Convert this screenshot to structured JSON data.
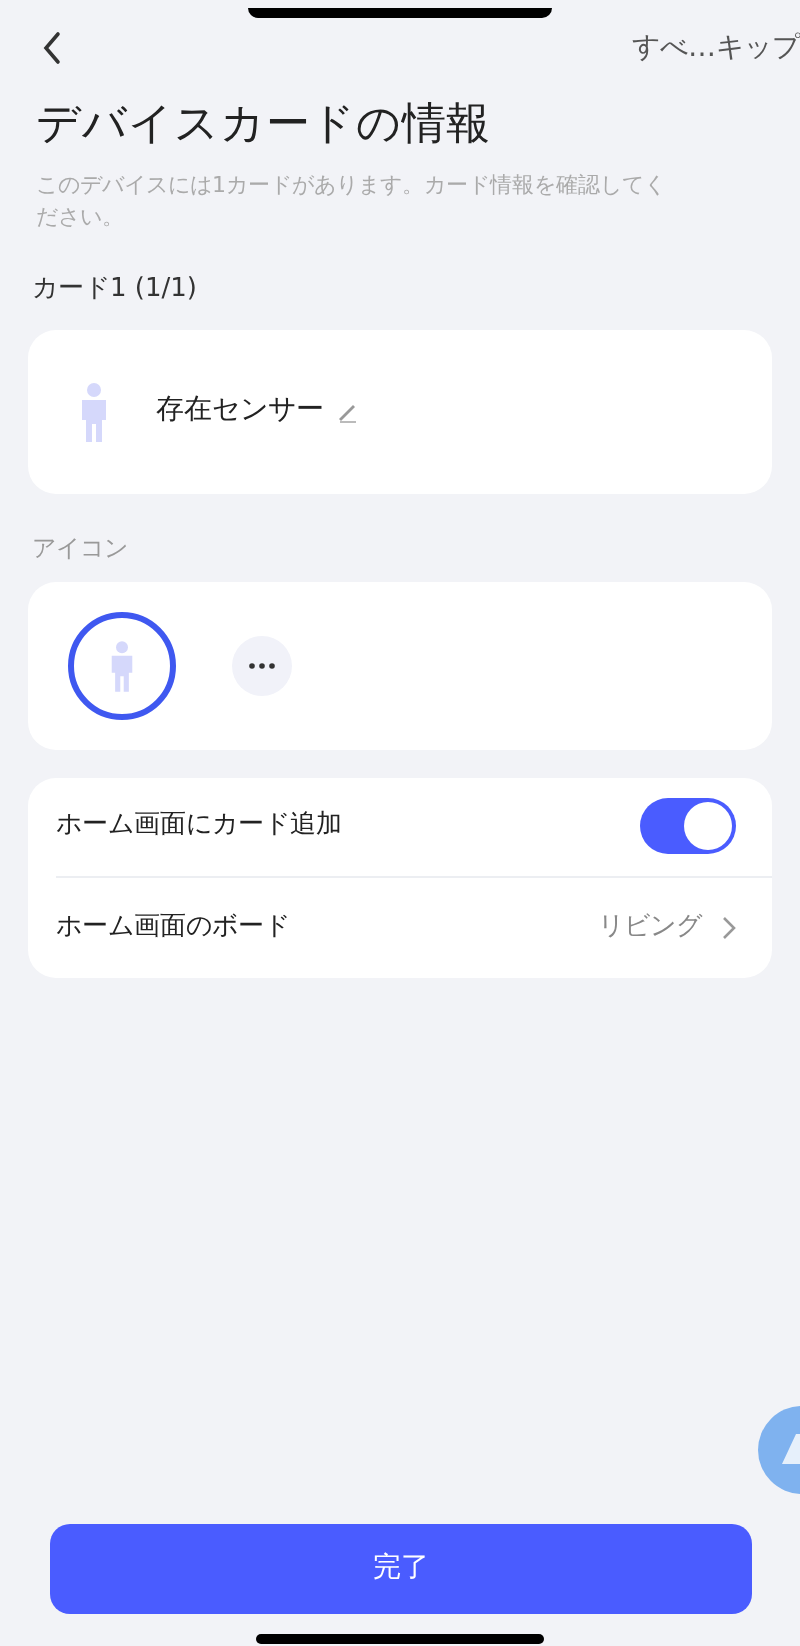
{
  "header": {
    "skip_label": "すべ…キップ"
  },
  "title": "デバイスカードの情報",
  "description": "このデバイスには1カードがあります。カード情報を確認してください。",
  "card_heading": "カード1 (1/1)",
  "card": {
    "name": "存在センサー"
  },
  "icon_section": {
    "label": "アイコン",
    "options": [
      {
        "kind": "person",
        "selected": true
      },
      {
        "kind": "more",
        "selected": false
      }
    ]
  },
  "settings": [
    {
      "kind": "toggle",
      "label": "ホーム画面にカード追加",
      "on": true
    },
    {
      "kind": "link",
      "label": "ホーム画面のボード",
      "value": "リビング"
    }
  ],
  "done_button": "完了"
}
